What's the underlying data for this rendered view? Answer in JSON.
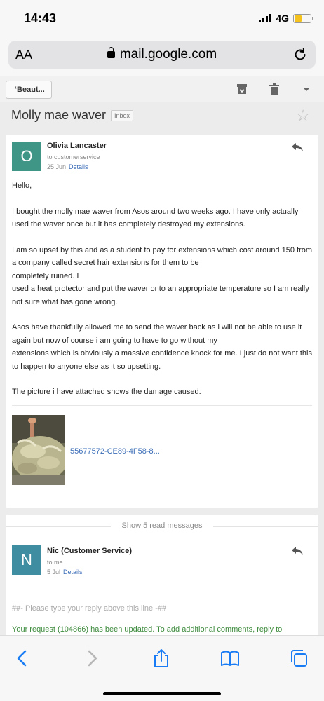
{
  "status_bar": {
    "time": "14:43",
    "network": "4G"
  },
  "browser": {
    "aa_label": "AA",
    "url": "mail.google.com"
  },
  "gmail_toolbar": {
    "back_label": "‘Beaut..."
  },
  "thread": {
    "subject": "Molly mae waver",
    "label": "Inbox"
  },
  "message1": {
    "avatar_letter": "O",
    "sender": "Olivia Lancaster",
    "to": "to customerservice",
    "date": "25 Jun",
    "details_label": "Details",
    "greeting": "Hello,",
    "paragraph1": "I bought the molly mae waver from Asos around two weeks ago. I have only actually used the waver once but it has completely destroyed my extensions.",
    "paragraph2_line1": "I am so upset by this and as a student to pay for extensions which cost around 150 from a company called secret hair extensions for them to be",
    "paragraph2_line2": "completely ruined. I",
    "paragraph2_line3": "used a heat protector and put the waver onto an appropriate temperature so I am really not sure what has gone wrong.",
    "paragraph3_line1": "Asos have thankfully allowed me to send the waver back as i will not be able to use it again but now of course i am going to have to go without my",
    "paragraph3_line2": "extensions which is obviously a massive confidence knock for me. I just do not want this to happen to anyone else as it so upsetting.",
    "paragraph4": "The picture i have attached shows the damage caused.",
    "attachment_name": "55677572-CE89-4F58-8..."
  },
  "collapsed": {
    "label": "Show 5 read messages"
  },
  "message2": {
    "avatar_letter": "N",
    "sender": "Nic (Customer Service)",
    "to": "to me",
    "date": "5 Jul",
    "details_label": "Details",
    "reply_marker": "##- Please type your reply above this line -##",
    "update_text": "Your request (104866) has been updated. To add additional comments, reply to"
  },
  "icons": [
    "lock-icon",
    "reload-icon",
    "archive-icon",
    "trash-icon",
    "chevron-down-icon",
    "star-icon",
    "reply-icon",
    "back-arrow-icon",
    "forward-arrow-icon",
    "share-icon",
    "bookmarks-icon",
    "tabs-icon"
  ],
  "colors": {
    "avatar_o": "#3f9686",
    "avatar_n": "#3f8da0",
    "link": "#3b6db8",
    "update_text": "#3d8b3d",
    "browser_blue": "#1a7cf4"
  }
}
